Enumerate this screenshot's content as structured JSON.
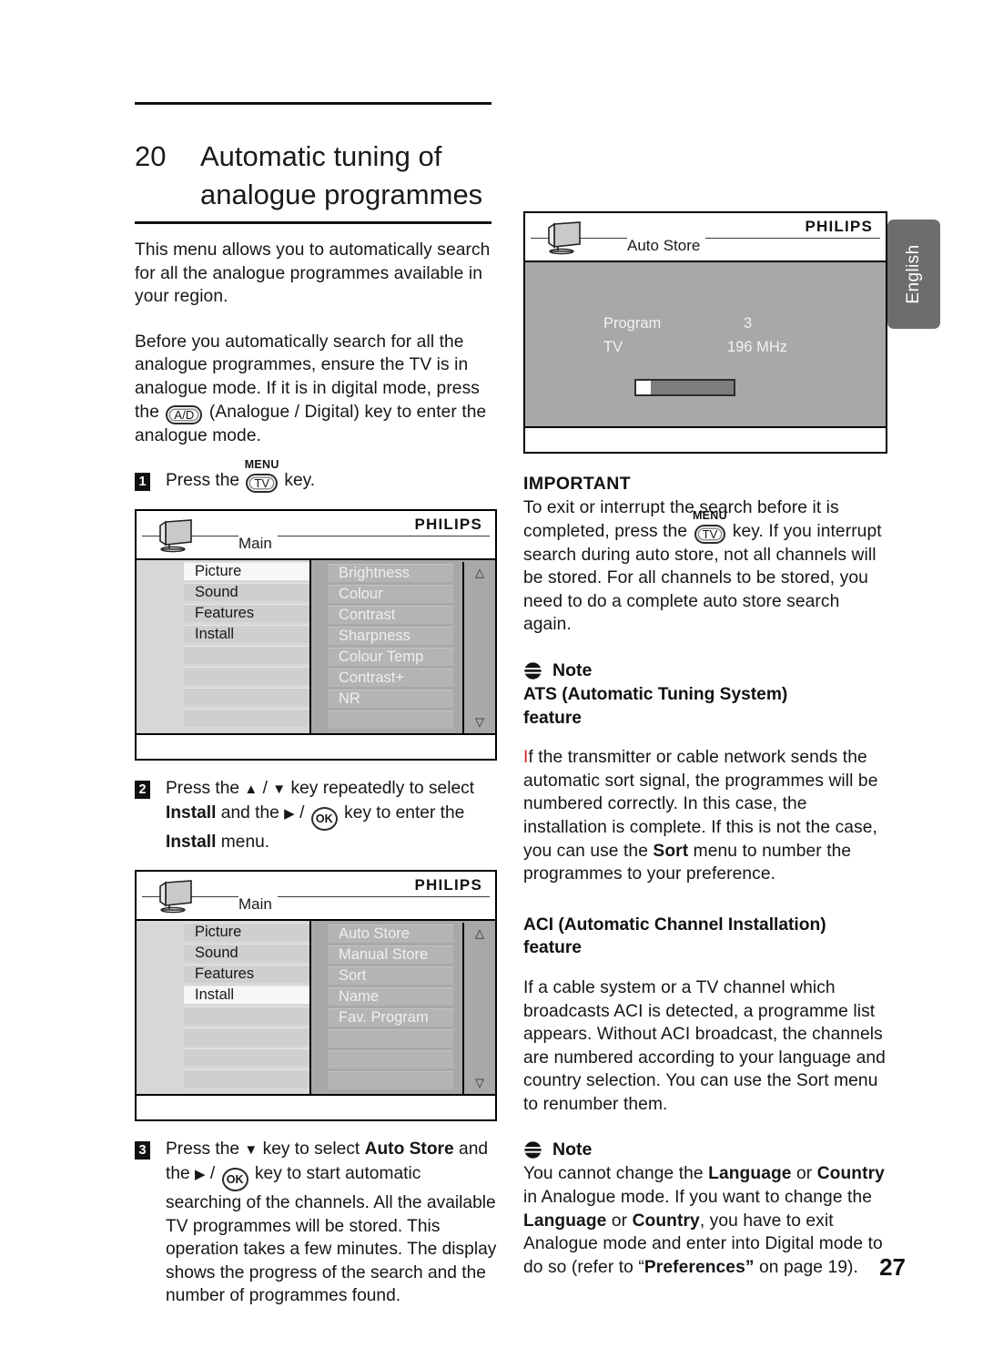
{
  "document": {
    "page_number": "27",
    "language_tab": "English"
  },
  "title": {
    "number": "20",
    "line1": "Automatic tuning of",
    "line2": "analogue programmes"
  },
  "left_column": {
    "intro": "This menu allows you to automatically search for all the analogue programmes available in your region.",
    "before_p1": "Before you automatically search for all the analogue programmes, ensure the TV is in analogue mode. If it is in digital mode, press the",
    "ad_key": "A/D",
    "before_p2": "(Analogue / Digital) key to enter the analogue mode.",
    "steps": [
      {
        "number": "1",
        "text_before": "Press the",
        "key_label": "MENU",
        "key_text": "TV",
        "text_after": "key."
      },
      {
        "number": "2",
        "part1": "Press the",
        "arrow_up": "▲",
        "slash": "/",
        "arrow_down": "▼",
        "part2": "key repeatedly to select",
        "bold1": "Install",
        "part3": "and the",
        "arrow_right": "▶",
        "ok_key": "OK",
        "part4": "key to enter the",
        "bold2": "Install",
        "part5": "menu."
      },
      {
        "number": "3",
        "part1": "Press the",
        "arrow_down": "▼",
        "part2": "key to select",
        "bold1": "Auto Store",
        "part3": "and the",
        "arrow_right": "▶",
        "ok_key": "OK",
        "part4": "key to start automatic searching of the channels. All the available TV programmes will be stored. This operation takes a few minutes. The display shows the progress of the search and the number of programmes found."
      }
    ]
  },
  "osd_main_menu": {
    "brand": "PHILIPS",
    "title": "Main",
    "tv_icon": "tv-monitor-icon",
    "left_items": [
      "Picture",
      "Sound",
      "Features",
      "Install"
    ],
    "left_selected": "Picture",
    "left_blank_rows": 4,
    "right_items": [
      "Brightness",
      "Colour",
      "Contrast",
      "Sharpness",
      "Colour Temp",
      "Contrast+",
      "NR"
    ],
    "right_blank_rows": 1,
    "scroll_up_icon": "△",
    "scroll_down_icon": "▽"
  },
  "osd_install_menu": {
    "brand": "PHILIPS",
    "title": "Main",
    "tv_icon": "tv-monitor-icon",
    "left_items": [
      "Picture",
      "Sound",
      "Features",
      "Install"
    ],
    "left_selected": "Install",
    "left_blank_rows": 4,
    "right_items": [
      "Auto Store",
      "Manual Store",
      "Sort",
      "Name",
      "Fav. Program"
    ],
    "right_blank_rows": 3,
    "scroll_up_icon": "△",
    "scroll_down_icon": "▽"
  },
  "osd_auto_store": {
    "brand": "PHILIPS",
    "title": "Auto Store",
    "tv_icon": "tv-monitor-icon",
    "program_label": "Program",
    "program_value": "3",
    "tv_label": "TV",
    "tv_value": "196 MHz",
    "progress_percent": 15
  },
  "right_column": {
    "important_heading": "IMPORTANT",
    "important_p1": "To exit or interrupt the search before it is completed, press the",
    "important_key_label": "MENU",
    "important_key_text": "TV",
    "important_p2": "key. If you interrupt search during auto store, not all channels will be stored. For all channels to be stored, you need to do a complete auto store search again.",
    "note1": {
      "icon": "note-icon",
      "title": "Note",
      "subhead_line1": "ATS (Automatic Tuning System)",
      "subhead_line2": "feature",
      "body_first_letter": "I",
      "body_part1": "f the transmitter or cable network sends the automatic sort signal, the programmes will be numbered correctly. In this case, the installation is complete. If this is not the case, you can use the",
      "bold1": "Sort",
      "body_part2": "menu to number the programmes to your preference."
    },
    "aci": {
      "subhead_line1": "ACI (Automatic Channel Installation)",
      "subhead_line2": "feature",
      "body": "If a cable system or a TV channel which broadcasts ACI is detected, a programme list appears. Without ACI broadcast, the channels are numbered according to your language and country selection. You can use the Sort menu to renumber them."
    },
    "note2": {
      "icon": "note-icon",
      "title": "Note",
      "part1": "You cannot change the",
      "bold1": "Language",
      "part2": "or",
      "bold2": "Country",
      "part3": "in Analogue mode. If you want to change the",
      "bold3": "Language",
      "part4": "or",
      "bold4": "Country",
      "part5": ", you have to exit Analogue mode and enter into Digital mode to do so (refer to “",
      "bold5": "Preferences”",
      "part6": "on page 19)."
    }
  }
}
